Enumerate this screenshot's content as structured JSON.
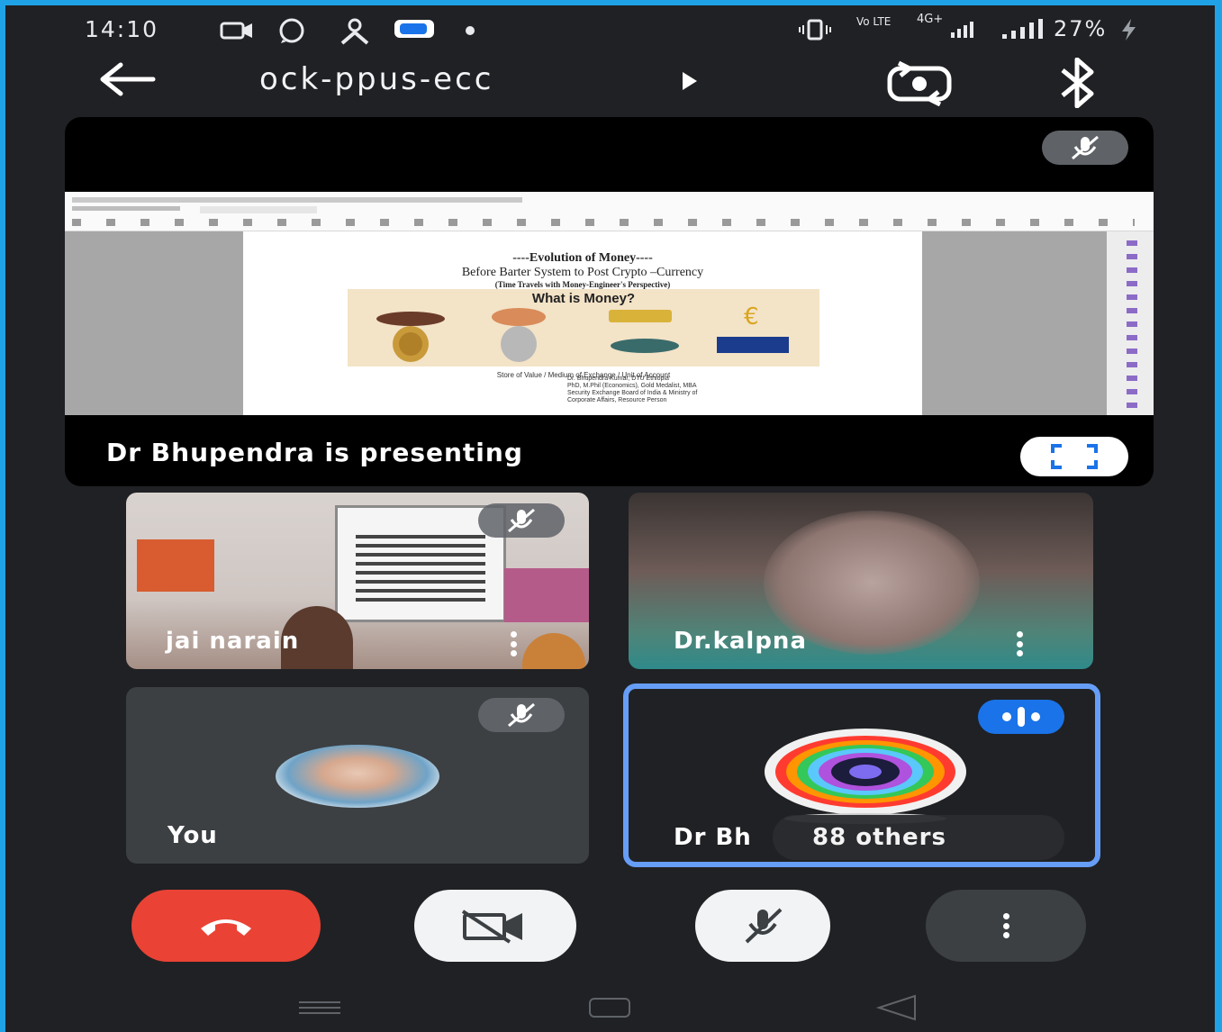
{
  "status_bar": {
    "time": "14:10",
    "network_label": "4G+",
    "carrier_label": "Vo LTE",
    "battery": "27%",
    "icons": [
      "camera-icon",
      "whatsapp-icon",
      "person-icon",
      "chat-bubble-icon",
      "dot-icon",
      "vibrate-icon",
      "volte-icon",
      "signal-4g-icon",
      "signal-bars-icon",
      "battery-charging-icon"
    ]
  },
  "top_bar": {
    "meeting_code": "ock-ppus-ecc",
    "back_icon": "arrow-left-icon",
    "switch_camera_icon": "switch-camera-icon",
    "audio_icon": "bluetooth-icon"
  },
  "presenting": {
    "caption": "Dr Bhupendra is presenting",
    "document": {
      "title": "----Evolution of Money----",
      "subtitle": "Before Barter System to Post Crypto –Currency",
      "tagline": "(Time Travels with Money-Engineer's Perspective)",
      "image_heading": "What is Money?",
      "image_caption": "Store of Value / Medium of Exchange / Unit of Account",
      "author_lines": [
        "Dr. Bhupendra Kumar, DTU Ethiopia",
        "PhD, M.Phil (Economics), Gold Medalist, MBA",
        "Security Exchange Board of India & Ministry of",
        "Corporate Affairs, Resource Person"
      ]
    }
  },
  "participants": [
    {
      "name": "jai narain",
      "muted": true
    },
    {
      "name": "Dr.kalpna",
      "muted": false
    },
    {
      "name": "You",
      "muted": true
    },
    {
      "name": "Dr Bh",
      "others_label": "88 others",
      "speaking": true
    }
  ],
  "controls": {
    "end_call": "end-call-icon",
    "camera": "camera-off-icon",
    "mic": "mic-off-icon",
    "more": "more-vertical-icon"
  },
  "colors": {
    "background": "#202124",
    "end_call": "#ea4335",
    "active_border": "#669df6",
    "frame": "#1fa3e6"
  }
}
